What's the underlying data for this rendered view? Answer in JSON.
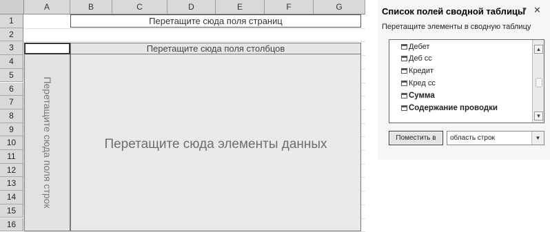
{
  "sheet": {
    "columns": [
      "A",
      "B",
      "C",
      "D",
      "E",
      "F",
      "G"
    ],
    "rows": [
      "1",
      "2",
      "3",
      "4",
      "5",
      "6",
      "7",
      "8",
      "9",
      "10",
      "11",
      "12",
      "13",
      "14",
      "15",
      "16"
    ],
    "page_drop_text": "Перетащите сюда поля страниц",
    "column_drop_text": "Перетащите сюда поля столбцов",
    "row_drop_text": "Перетащите сюда поля строк",
    "data_drop_text": "Перетащите сюда элементы данных"
  },
  "field_pane": {
    "title": "Список полей сводной таблицы",
    "menu_icon": "dropdown-arrow",
    "close_icon": "close-x",
    "subtitle": "Перетащите элементы в сводную таблицу",
    "fields": [
      {
        "label": "Дебет",
        "bold": false
      },
      {
        "label": "Деб сс",
        "bold": false
      },
      {
        "label": "Кредит",
        "bold": false
      },
      {
        "label": "Кред сс",
        "bold": false
      },
      {
        "label": "Сумма",
        "bold": true
      },
      {
        "label": "Содержание проводки",
        "bold": true
      }
    ],
    "place_button": "Поместить в",
    "area_select": "область строк"
  }
}
